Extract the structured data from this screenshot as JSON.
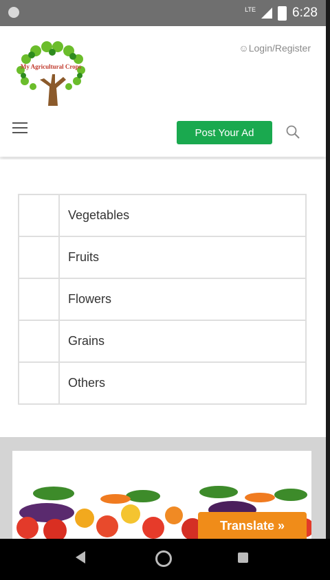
{
  "status_bar": {
    "network": "LTE",
    "time": "6:28"
  },
  "header": {
    "logo_text": "My Agricultural Crops",
    "login_label": "Login/Register",
    "post_ad_label": "Post Your Ad"
  },
  "categories": [
    "Vegetables",
    "Fruits",
    "Flowers",
    "Grains",
    "Others"
  ],
  "translate_label": "Translate »",
  "colors": {
    "accent_green": "#1aa94f",
    "translate_orange": "#f08c19"
  }
}
